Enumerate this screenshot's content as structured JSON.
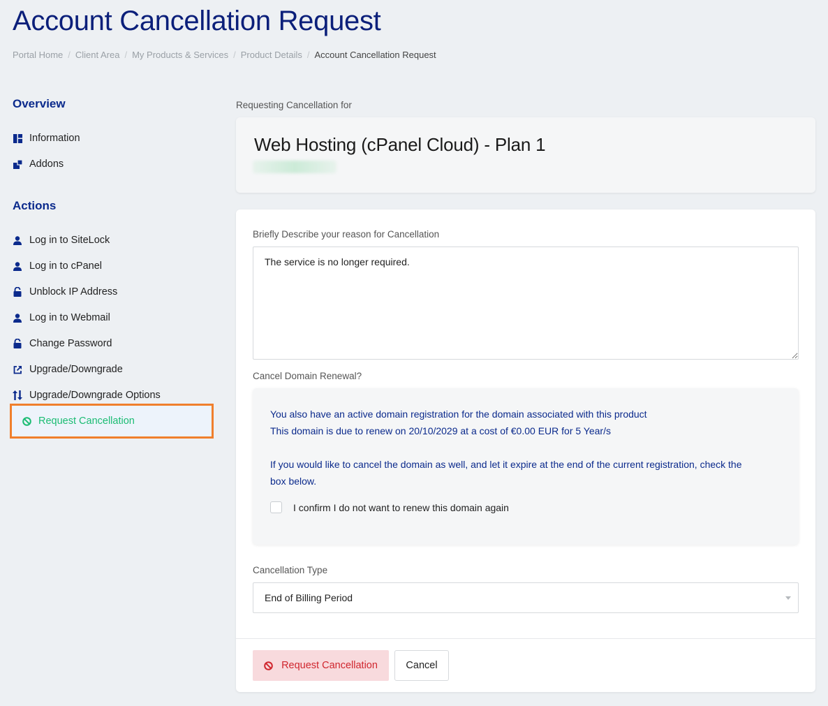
{
  "page": {
    "title": "Account Cancellation Request"
  },
  "breadcrumb": [
    "Portal Home",
    "Client Area",
    "My Products & Services",
    "Product Details",
    "Account Cancellation Request"
  ],
  "sidebar": {
    "overview_heading": "Overview",
    "overview_items": [
      {
        "label": "Information",
        "icon": "dashboard-icon"
      },
      {
        "label": "Addons",
        "icon": "cubes-icon"
      }
    ],
    "actions_heading": "Actions",
    "action_items": [
      {
        "label": "Log in to SiteLock",
        "icon": "user-icon"
      },
      {
        "label": "Log in to cPanel",
        "icon": "user-icon"
      },
      {
        "label": "Unblock IP Address",
        "icon": "unlock-icon"
      },
      {
        "label": "Log in to Webmail",
        "icon": "user-icon"
      },
      {
        "label": "Change Password",
        "icon": "unlock-icon"
      },
      {
        "label": "Upgrade/Downgrade",
        "icon": "external-link-icon"
      },
      {
        "label": "Upgrade/Downgrade Options",
        "icon": "sort-icon"
      },
      {
        "label": "Request Cancellation",
        "icon": "ban-icon",
        "active": true
      }
    ]
  },
  "main": {
    "requesting_label": "Requesting Cancellation for",
    "product_name": "Web Hosting (cPanel Cloud) - Plan 1",
    "reason_label": "Briefly Describe your reason for Cancellation",
    "reason_value": "The service is no longer required.",
    "domain_renewal_label": "Cancel Domain Renewal?",
    "domain_notice": {
      "line1": "You also have an active domain registration for the domain associated with this product",
      "line2": "This domain is due to renew on 20/10/2029 at a cost of €0.00 EUR for 5 Year/s",
      "line3": "If you would like to cancel the domain as well, and let it expire at the end of the current registration, check the",
      "line4": "box below.",
      "confirm_label": "I confirm I do not want to renew this domain again"
    },
    "cancellation_type_label": "Cancellation Type",
    "cancellation_type_value": "End of Billing Period",
    "request_button": "Request Cancellation",
    "cancel_button": "Cancel"
  },
  "colors": {
    "title": "#0b1f7a",
    "active_nav_text": "#1bbc73",
    "active_nav_border": "#f07f2c",
    "danger": "#d0262e"
  }
}
